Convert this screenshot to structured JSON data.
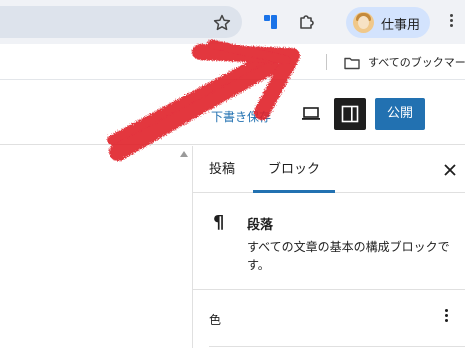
{
  "browser": {
    "profile_name": "仕事用",
    "bookmarks_label": "すべてのブックマーク",
    "icons": [
      "star-icon",
      "extension-blue-icon",
      "puzzle-icon",
      "avatar",
      "kebab-menu-icon",
      "folder-icon"
    ]
  },
  "editor_header": {
    "save_draft": "下書き保存",
    "publish": "公開",
    "icons": [
      "preview-laptop-icon",
      "sidebar-toggle-icon"
    ]
  },
  "settings_sidebar": {
    "tabs": [
      {
        "label": "投稿",
        "active": false
      },
      {
        "label": "ブロック",
        "active": true
      }
    ],
    "block": {
      "icon": "¶",
      "title": "段落",
      "description": "すべての文章の基本の構成ブロックです。"
    },
    "color_panel": {
      "label": "色"
    }
  },
  "colors": {
    "accent": "#2271b1",
    "profile_pill": "#d3e3fd",
    "annotation_arrow": "#e0202a"
  }
}
